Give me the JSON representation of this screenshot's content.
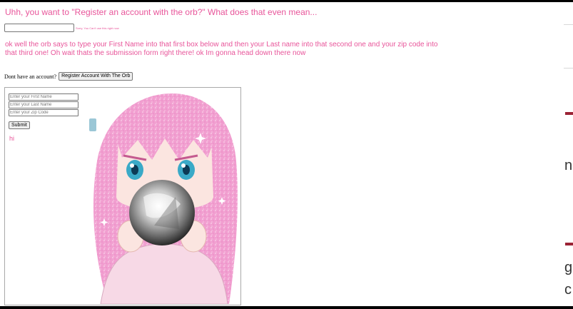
{
  "heading": "Uhh, you want to \"Register an account with the orb?\" What does that even mean...",
  "guess_field": {
    "value": "",
    "placeholder": ""
  },
  "tiny_note": "Sorry, You Can't use this right now",
  "orb_instructions": "ok well the orb says to type your First Name into that first box below and then your Last name into that second one and your zip code into that third one! Oh wait thats the submission form right there! ok Im gonna head down there now",
  "account_prompt": "Dont have an account?",
  "register_button_label": "Register Account With The Orb",
  "form": {
    "first_name_placeholder": "Enter your First Name",
    "last_name_placeholder": "Enter your Last Name",
    "zip_placeholder": "Enter your Zip Code",
    "submit_label": "Submit",
    "status_text": "hi"
  },
  "colors": {
    "pink_text": "#e8559a",
    "hair_pink": "#f3a6d2",
    "orb_gray": "#b8b8b8",
    "accent_red": "#9b2335"
  },
  "background_page_text": [
    "n",
    "g",
    "c"
  ]
}
